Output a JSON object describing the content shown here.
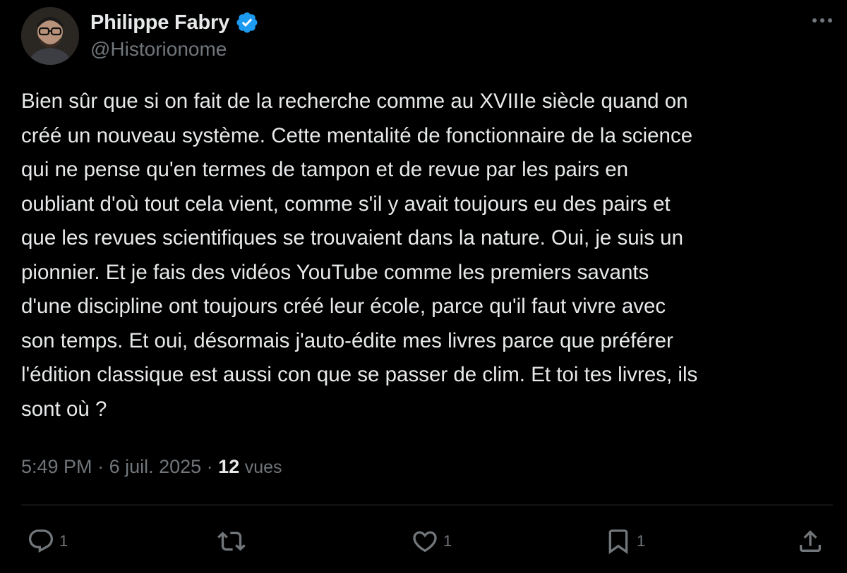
{
  "author": {
    "display_name": "Philippe Fabry",
    "handle": "@Historionome",
    "verified": true,
    "verified_color": "#1d9bf0",
    "avatar_icon": "avatar-photo"
  },
  "tweet": {
    "lines": [
      "Bien sûr que si on fait de la recherche comme au XVIIIe siècle quand on",
      "créé un nouveau système. Cette mentalité de fonctionnaire de la science",
      "qui ne pense qu'en termes de tampon et de revue par les pairs en",
      "oubliant d'où tout cela vient,  comme s'il y avait toujours eu des pairs et",
      "que les revues scientifiques se trouvaient dans la nature. Oui, je suis un",
      "pionnier. Et je fais des vidéos YouTube comme les premiers savants",
      "d'une discipline ont toujours créé leur école, parce qu'il faut vivre avec",
      "son temps. Et oui, désormais j'auto-édite mes livres parce que préférer",
      "l'édition classique est aussi con que se passer de clim. Et toi tes livres, ils",
      "sont où ?"
    ]
  },
  "meta": {
    "time": "5:49 PM",
    "separator": " · ",
    "date": "6 juil. 2025",
    "views_count": "12",
    "views_label": "vues"
  },
  "actions": {
    "reply": {
      "icon": "reply-icon",
      "count": "1"
    },
    "repost": {
      "icon": "repost-icon",
      "count": ""
    },
    "like": {
      "icon": "heart-icon",
      "count": "1"
    },
    "bookmark": {
      "icon": "bookmark-icon",
      "count": "1"
    },
    "share": {
      "icon": "share-icon"
    }
  },
  "colors": {
    "background": "#000000",
    "text_primary": "#e7e9ea",
    "text_secondary": "#71767b",
    "divider": "#2f3336"
  }
}
